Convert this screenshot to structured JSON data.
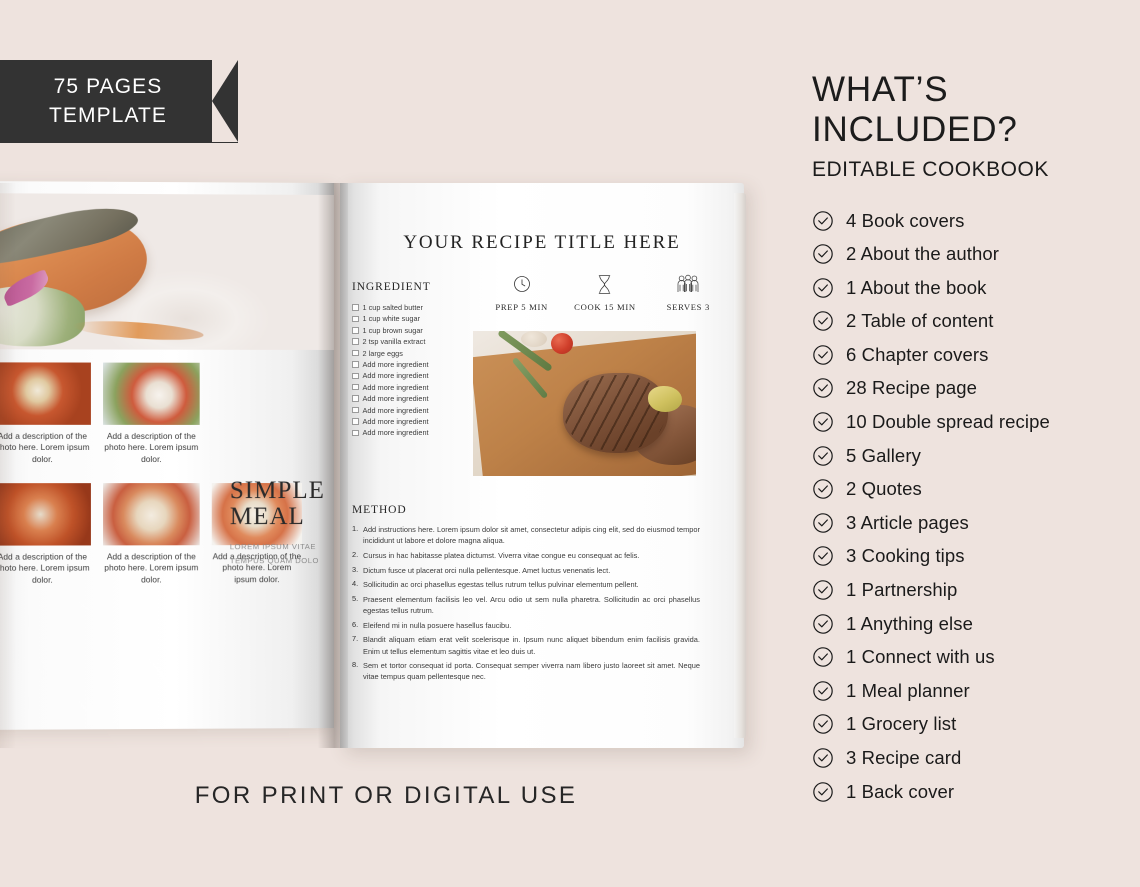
{
  "theme": {
    "background": "#EEE3DE",
    "ribbon_bg": "#333333",
    "text_dark": "#1A1A1A"
  },
  "ribbon": {
    "line1": "75 PAGES",
    "line2": "TEMPLATE"
  },
  "right_panel": {
    "title_line1": "WHAT’S",
    "title_line2": "INCLUDED?",
    "subtitle": "EDITABLE COOKBOOK",
    "checklist": [
      {
        "label": "4 Book covers",
        "icon": "check-circle-icon"
      },
      {
        "label": "2 About the author",
        "icon": "check-circle-icon"
      },
      {
        "label": "1 About the book",
        "icon": "check-circle-icon"
      },
      {
        "label": "2 Table of content",
        "icon": "check-circle-icon"
      },
      {
        "label": "6 Chapter covers",
        "icon": "check-circle-icon"
      },
      {
        "label": "28 Recipe page",
        "icon": "check-circle-icon"
      },
      {
        "label": "10 Double spread recipe",
        "icon": "check-circle-icon"
      },
      {
        "label": "5 Gallery",
        "icon": "check-circle-icon"
      },
      {
        "label": "2 Quotes",
        "icon": "check-circle-icon"
      },
      {
        "label": "3 Article pages",
        "icon": "check-circle-icon"
      },
      {
        "label": "3 Cooking tips",
        "icon": "check-circle-icon"
      },
      {
        "label": "1 Partnership",
        "icon": "check-circle-icon"
      },
      {
        "label": "1 Anything else",
        "icon": "check-circle-icon"
      },
      {
        "label": "1 Connect with us",
        "icon": "check-circle-icon"
      },
      {
        "label": "1 Meal planner",
        "icon": "check-circle-icon"
      },
      {
        "label": "1 Grocery list",
        "icon": "check-circle-icon"
      },
      {
        "label": "3 Recipe card",
        "icon": "check-circle-icon"
      },
      {
        "label": "1 Back cover",
        "icon": "check-circle-icon"
      }
    ]
  },
  "book": {
    "bottom_caption": "FOR PRINT OR DIGITAL USE",
    "left_page": {
      "hero_photo_alt": "seared salmon fillet with herb rice on white plate",
      "headline_line1": "SIMPLE",
      "headline_line2": "MEAL",
      "subtext_line1": "LOREM IPSUM  VITAE",
      "subtext_line2": "TEMPUS QUAM DOLO",
      "thumbnails": [
        {
          "alt": "spaghetti bolognese",
          "caption": "Add a description of the photo here. Lorem ipsum dolor."
        },
        {
          "alt": "tomato mozzarella salad",
          "caption": "Add a description of the photo here. Lorem ipsum dolor."
        },
        {
          "alt": "penne arrabbiata",
          "caption": "Add a description of the photo here. Lorem ipsum dolor."
        },
        {
          "alt": "shrimp pasta",
          "caption": "Add a description of the photo here. Lorem ipsum dolor."
        },
        {
          "alt": "salmon on cream sauce",
          "caption": "Add a description of the photo here. Lorem ipsum dolor."
        }
      ]
    },
    "right_page": {
      "recipe_title": "YOUR RECIPE TITLE HERE",
      "ingredient_heading": "INGREDIENT",
      "ingredients": [
        "1 cup salted butter",
        "1 cup white sugar",
        "1 cup brown sugar",
        "2 tsp vanilla extract",
        "2 large eggs",
        "Add more ingredient",
        "Add more ingredient",
        "Add more ingredient",
        "Add more ingredient",
        "Add more ingredient",
        "Add more ingredient",
        "Add more ingredient"
      ],
      "meta": [
        {
          "icon": "clock-icon",
          "label": "PREP 5 MIN"
        },
        {
          "icon": "hourglass-icon",
          "label": "COOK 15 MIN"
        },
        {
          "icon": "people-icon",
          "label": "SERVES 3"
        }
      ],
      "photo_alt": "grilled steak with rosemary on wooden board",
      "method_heading": "METHOD",
      "method": [
        {
          "num": "1.",
          "text": "Add instructions here. Lorem ipsum dolor sit amet, consectetur adipis cing elit, sed do eiusmod tempor incididunt ut labore et dolore magna aliqua."
        },
        {
          "num": "2.",
          "text": "Cursus in hac habitasse platea dictumst. Viverra vitae congue eu consequat ac felis."
        },
        {
          "num": "3.",
          "text": "Dictum fusce ut placerat orci nulla pellentesque. Amet luctus venenatis lect."
        },
        {
          "num": "4.",
          "text": "Sollicitudin ac orci phasellus egestas tellus rutrum tellus pulvinar elementum pellent."
        },
        {
          "num": "5.",
          "text": "Praesent elementum facilisis leo vel. Arcu odio ut sem nulla pharetra. Sollicitudin ac orci phasellus egestas tellus rutrum."
        },
        {
          "num": "6.",
          "text": "Eleifend mi in nulla posuere hasellus faucibu."
        },
        {
          "num": "7.",
          "text": "Blandit aliquam etiam erat velit scelerisque in. Ipsum nunc aliquet bibendum enim facilisis gravida. Enim ut tellus elementum sagittis vitae et leo duis ut."
        },
        {
          "num": "8.",
          "text": "Sem et tortor consequat id porta. Consequat semper viverra nam libero justo laoreet sit amet. Neque vitae tempus quam pellentesque nec."
        }
      ]
    }
  }
}
